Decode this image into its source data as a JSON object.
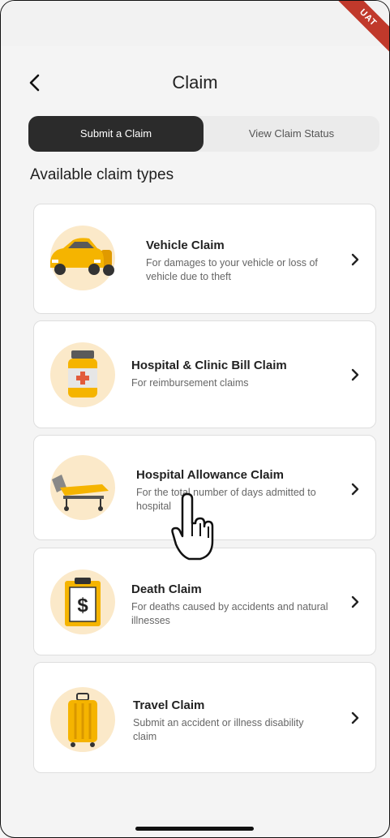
{
  "header": {
    "title": "Claim",
    "env_badge": "UAT"
  },
  "tabs": [
    {
      "label": "Submit a Claim",
      "active": true
    },
    {
      "label": "View Claim Status",
      "active": false
    }
  ],
  "section_title": "Available claim types",
  "claims": [
    {
      "title": "Vehicle Claim",
      "desc": "For damages to your vehicle or loss of vehicle due to theft",
      "icon": "vehicle-icon"
    },
    {
      "title": "Hospital & Clinic Bill Claim",
      "desc": "For reimbursement claims",
      "icon": "medicine-bottle-icon"
    },
    {
      "title": "Hospital Allowance Claim",
      "desc": "For the total number of days admitted to hospital",
      "icon": "hospital-bed-icon"
    },
    {
      "title": "Death Claim",
      "desc": "For deaths caused by accidents and natural illnesses",
      "icon": "clipboard-dollar-icon"
    },
    {
      "title": "Travel Claim",
      "desc": "Submit an accident or illness disability claim",
      "icon": "suitcase-icon"
    }
  ],
  "colors": {
    "accent": "#f5b400",
    "icon_bg": "#fbe9c9",
    "tab_active": "#2b2b2b",
    "badge": "#c0392b"
  }
}
